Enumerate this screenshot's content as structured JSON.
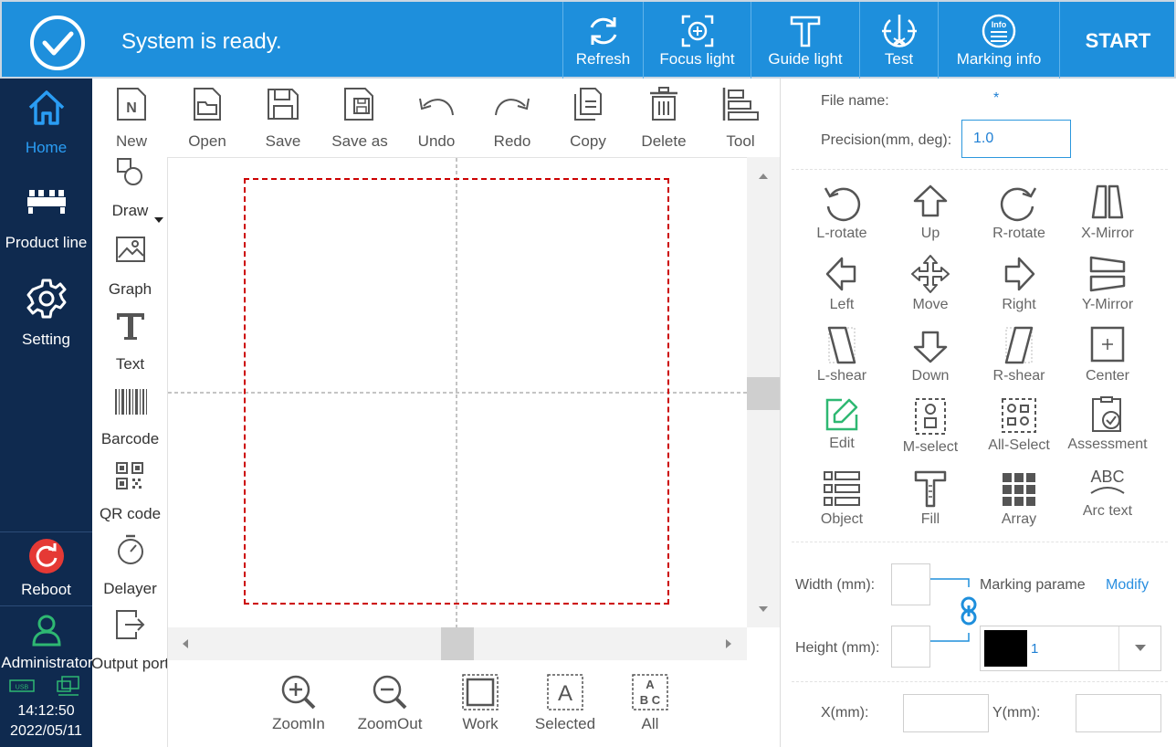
{
  "status": {
    "message": "System is ready."
  },
  "top_actions": [
    {
      "label": "Refresh",
      "icon": "refresh-icon"
    },
    {
      "label": "Focus light",
      "icon": "focus-light-icon"
    },
    {
      "label": "Guide light",
      "icon": "guide-light-icon"
    },
    {
      "label": "Test",
      "icon": "test-icon"
    },
    {
      "label": "Marking info",
      "icon": "info-icon"
    }
  ],
  "start_label": "START",
  "sidebar": {
    "items": [
      {
        "label": "Home",
        "icon": "home-icon",
        "active": true
      },
      {
        "label": "Product line",
        "icon": "product-line-icon"
      },
      {
        "label": "Setting",
        "icon": "gear-icon"
      }
    ],
    "reboot": "Reboot",
    "user": "Administrator",
    "status_icons": [
      "usb-icon",
      "network-icon"
    ],
    "time": "14:12:50",
    "date": "2022/05/11"
  },
  "toolbar": [
    {
      "label": "New",
      "icon": "new-file-icon"
    },
    {
      "label": "Open",
      "icon": "open-folder-icon"
    },
    {
      "label": "Save",
      "icon": "save-icon"
    },
    {
      "label": "Save as",
      "icon": "save-as-icon"
    },
    {
      "label": "Undo",
      "icon": "undo-icon"
    },
    {
      "label": "Redo",
      "icon": "redo-icon"
    },
    {
      "label": "Copy",
      "icon": "copy-icon"
    },
    {
      "label": "Delete",
      "icon": "delete-icon"
    },
    {
      "label": "Tool",
      "icon": "align-tool-icon"
    }
  ],
  "tools": [
    {
      "label": "Draw",
      "icon": "draw-shapes-icon"
    },
    {
      "label": "Graph",
      "icon": "image-icon"
    },
    {
      "label": "Text",
      "icon": "text-icon"
    },
    {
      "label": "Barcode",
      "icon": "barcode-icon"
    },
    {
      "label": "QR code",
      "icon": "qr-code-icon"
    },
    {
      "label": "Delayer",
      "icon": "timer-icon"
    },
    {
      "label": "Output port",
      "icon": "output-port-icon"
    }
  ],
  "zoom_bar": [
    {
      "label": "ZoomIn",
      "icon": "zoom-in-icon"
    },
    {
      "label": "ZoomOut",
      "icon": "zoom-out-icon"
    },
    {
      "label": "Work",
      "icon": "work-area-icon"
    },
    {
      "label": "Selected",
      "icon": "selected-icon"
    },
    {
      "label": "All",
      "icon": "all-icon"
    }
  ],
  "file": {
    "name_label": "File name:",
    "name_value": "*",
    "precision_label": "Precision(mm, deg):",
    "precision_value": "1.0"
  },
  "edit_tools": [
    {
      "label": "L-rotate",
      "icon": "rotate-left-icon"
    },
    {
      "label": "Up",
      "icon": "arrow-up-icon"
    },
    {
      "label": "R-rotate",
      "icon": "rotate-right-icon"
    },
    {
      "label": "X-Mirror",
      "icon": "x-mirror-icon"
    },
    {
      "label": "Left",
      "icon": "arrow-left-icon"
    },
    {
      "label": "Move",
      "icon": "move-icon"
    },
    {
      "label": "Right",
      "icon": "arrow-right-icon"
    },
    {
      "label": "Y-Mirror",
      "icon": "y-mirror-icon"
    },
    {
      "label": "L-shear",
      "icon": "left-shear-icon"
    },
    {
      "label": "Down",
      "icon": "arrow-down-icon"
    },
    {
      "label": "R-shear",
      "icon": "right-shear-icon"
    },
    {
      "label": "Center",
      "icon": "center-icon"
    },
    {
      "label": "Edit",
      "icon": "edit-icon"
    },
    {
      "label": "M-select",
      "icon": "multi-select-icon"
    },
    {
      "label": "All-Select",
      "icon": "select-all-icon"
    },
    {
      "label": "Assessment",
      "icon": "assessment-icon"
    },
    {
      "label": "Object",
      "icon": "object-list-icon"
    },
    {
      "label": "Fill",
      "icon": "fill-icon"
    },
    {
      "label": "Array",
      "icon": "array-icon"
    },
    {
      "label": "Arc text",
      "icon": "arc-text-icon"
    }
  ],
  "dimensions": {
    "width_label": "Width (mm):",
    "height_label": "Height (mm):",
    "marking_label": "Marking parame",
    "modify_label": "Modify",
    "param_value": "1",
    "param_color": "#000000"
  },
  "position": {
    "x_label": "X(mm):",
    "y_label": "Y(mm):"
  },
  "colors": {
    "accent": "#1e8fdc",
    "sidebar": "#0f2a4f",
    "work_area_border": "#cc0000",
    "edit_active": "#2eb872"
  }
}
